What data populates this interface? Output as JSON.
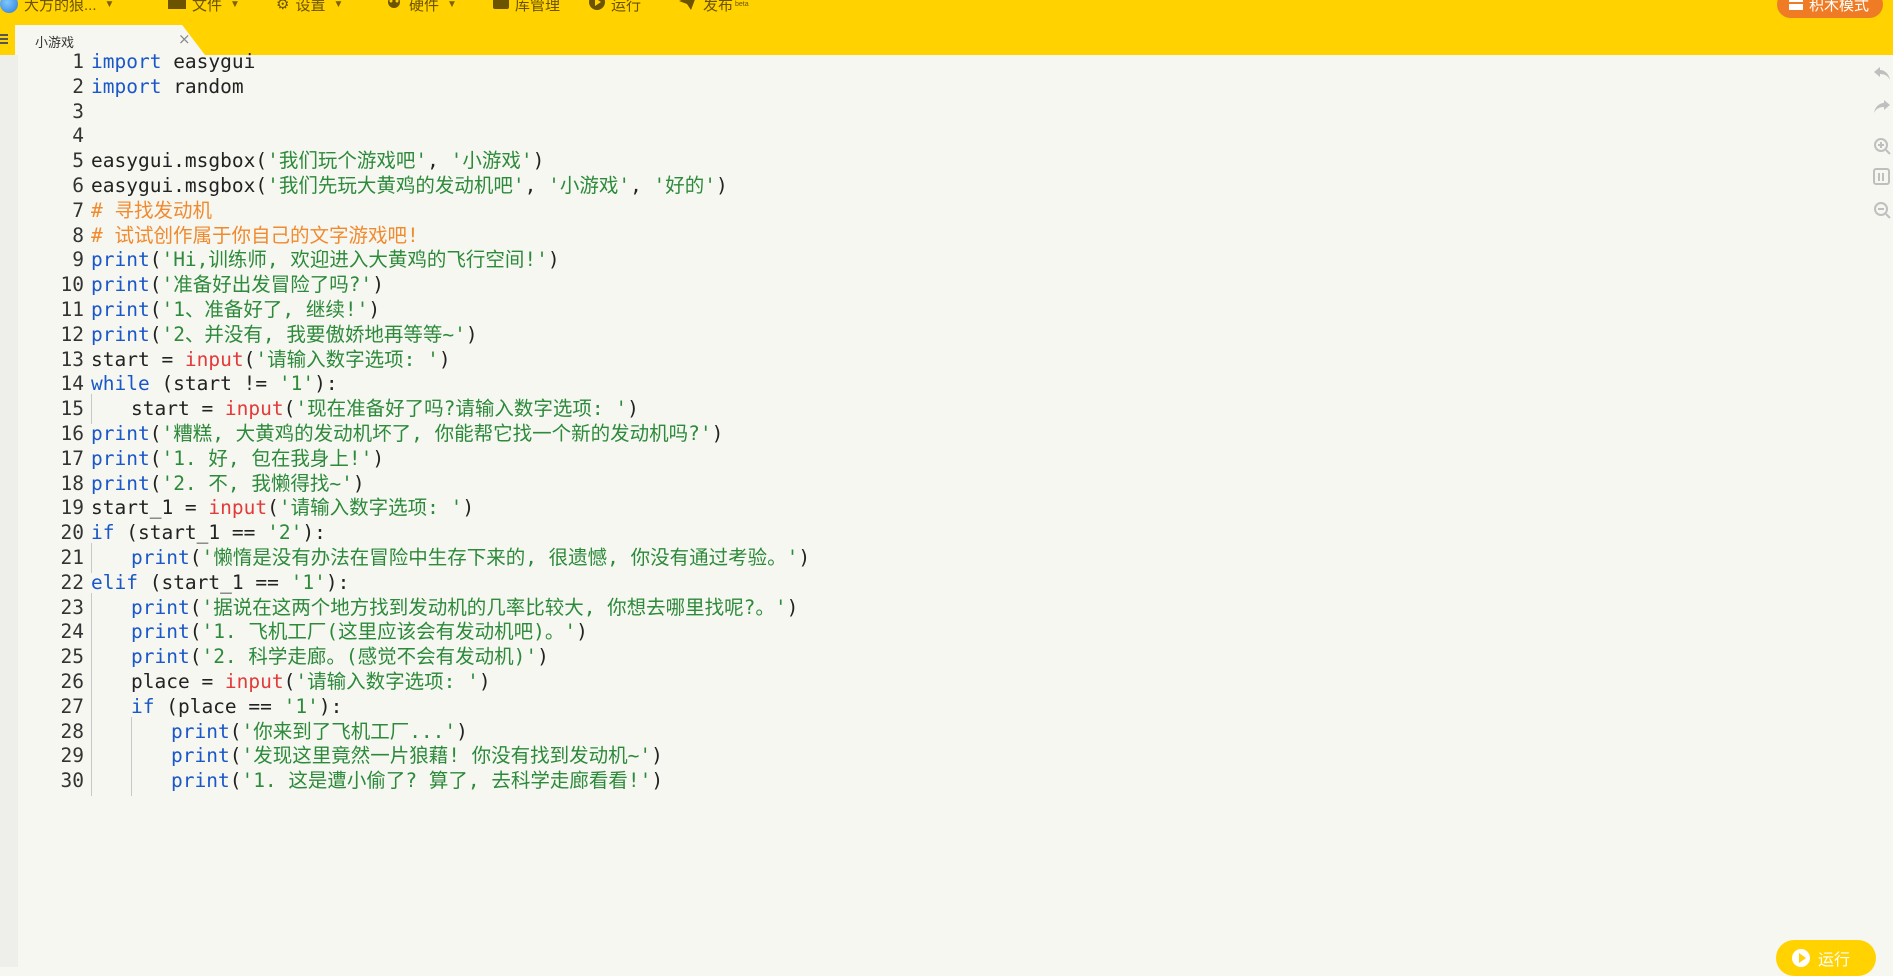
{
  "menu": {
    "project_name": "大方的狼...",
    "items": [
      "文件",
      "设置",
      "硬件",
      "库管理",
      "运行",
      "发布"
    ],
    "publish_badge": "beta",
    "mode_button": "积木模式"
  },
  "tab": {
    "label": "小游戏"
  },
  "run_button": "运行",
  "colors": {
    "topbar": "#ffd200",
    "keyword": "#1a57c8",
    "builtin": "#e33a3a",
    "string": "#2c8a3a",
    "comment": "#f08a2d",
    "mode_button": "#ef7c24"
  },
  "code_lines": [
    {
      "n": "1",
      "indent": 0,
      "tokens": [
        [
          "kw",
          "import"
        ],
        [
          "t",
          " easygui"
        ]
      ]
    },
    {
      "n": "2",
      "indent": 0,
      "tokens": [
        [
          "kw",
          "import"
        ],
        [
          "t",
          " random"
        ]
      ]
    },
    {
      "n": "3",
      "indent": 0,
      "tokens": []
    },
    {
      "n": "4",
      "indent": 0,
      "tokens": []
    },
    {
      "n": "5",
      "indent": 0,
      "tokens": [
        [
          "t",
          "easygui.msgbox("
        ],
        [
          "str",
          "'我们玩个游戏吧'"
        ],
        [
          "t",
          ", "
        ],
        [
          "str",
          "'小游戏'"
        ],
        [
          "t",
          ")"
        ]
      ]
    },
    {
      "n": "6",
      "indent": 0,
      "tokens": [
        [
          "t",
          "easygui.msgbox("
        ],
        [
          "str",
          "'我们先玩大黄鸡的发动机吧'"
        ],
        [
          "t",
          ", "
        ],
        [
          "str",
          "'小游戏'"
        ],
        [
          "t",
          ", "
        ],
        [
          "str",
          "'好的'"
        ],
        [
          "t",
          ")"
        ]
      ]
    },
    {
      "n": "7",
      "indent": 0,
      "tokens": [
        [
          "cm",
          "# 寻找发动机"
        ]
      ]
    },
    {
      "n": "8",
      "indent": 0,
      "tokens": [
        [
          "cm",
          "# 试试创作属于你自己的文字游戏吧!"
        ]
      ]
    },
    {
      "n": "9",
      "indent": 0,
      "tokens": [
        [
          "kw",
          "print"
        ],
        [
          "t",
          "("
        ],
        [
          "str",
          "'Hi,训练师, 欢迎进入大黄鸡的飞行空间!'"
        ],
        [
          "t",
          ")"
        ]
      ]
    },
    {
      "n": "10",
      "indent": 0,
      "tokens": [
        [
          "kw",
          "print"
        ],
        [
          "t",
          "("
        ],
        [
          "str",
          "'准备好出发冒险了吗?'"
        ],
        [
          "t",
          ")"
        ]
      ]
    },
    {
      "n": "11",
      "indent": 0,
      "tokens": [
        [
          "kw",
          "print"
        ],
        [
          "t",
          "("
        ],
        [
          "str",
          "'1、准备好了, 继续!'"
        ],
        [
          "t",
          ")"
        ]
      ]
    },
    {
      "n": "12",
      "indent": 0,
      "tokens": [
        [
          "kw",
          "print"
        ],
        [
          "t",
          "("
        ],
        [
          "str",
          "'2、并没有, 我要傲娇地再等等~'"
        ],
        [
          "t",
          ")"
        ]
      ]
    },
    {
      "n": "13",
      "indent": 0,
      "tokens": [
        [
          "t",
          "start = "
        ],
        [
          "fn",
          "input"
        ],
        [
          "t",
          "("
        ],
        [
          "str",
          "'请输入数字选项: '"
        ],
        [
          "t",
          ")"
        ]
      ]
    },
    {
      "n": "14",
      "indent": 0,
      "tokens": [
        [
          "kw",
          "while"
        ],
        [
          "t",
          " (start != "
        ],
        [
          "str",
          "'1'"
        ],
        [
          "t",
          "):"
        ]
      ]
    },
    {
      "n": "15",
      "indent": 1,
      "tokens": [
        [
          "t",
          "start = "
        ],
        [
          "fn",
          "input"
        ],
        [
          "t",
          "("
        ],
        [
          "str",
          "'现在准备好了吗?请输入数字选项: '"
        ],
        [
          "t",
          ")"
        ]
      ]
    },
    {
      "n": "16",
      "indent": 0,
      "tokens": [
        [
          "kw",
          "print"
        ],
        [
          "t",
          "("
        ],
        [
          "str",
          "'糟糕, 大黄鸡的发动机坏了, 你能帮它找一个新的发动机吗?'"
        ],
        [
          "t",
          ")"
        ]
      ]
    },
    {
      "n": "17",
      "indent": 0,
      "tokens": [
        [
          "kw",
          "print"
        ],
        [
          "t",
          "("
        ],
        [
          "str",
          "'1. 好, 包在我身上!'"
        ],
        [
          "t",
          ")"
        ]
      ]
    },
    {
      "n": "18",
      "indent": 0,
      "tokens": [
        [
          "kw",
          "print"
        ],
        [
          "t",
          "("
        ],
        [
          "str",
          "'2. 不, 我懒得找~'"
        ],
        [
          "t",
          ")"
        ]
      ]
    },
    {
      "n": "19",
      "indent": 0,
      "tokens": [
        [
          "t",
          "start_1 = "
        ],
        [
          "fn",
          "input"
        ],
        [
          "t",
          "("
        ],
        [
          "str",
          "'请输入数字选项: '"
        ],
        [
          "t",
          ")"
        ]
      ]
    },
    {
      "n": "20",
      "indent": 0,
      "tokens": [
        [
          "kw",
          "if"
        ],
        [
          "t",
          " (start_1 == "
        ],
        [
          "str",
          "'2'"
        ],
        [
          "t",
          "):"
        ]
      ]
    },
    {
      "n": "21",
      "indent": 1,
      "tokens": [
        [
          "kw",
          "print"
        ],
        [
          "t",
          "("
        ],
        [
          "str",
          "'懒惰是没有办法在冒险中生存下来的, 很遗憾, 你没有通过考验。'"
        ],
        [
          "t",
          ")"
        ]
      ]
    },
    {
      "n": "22",
      "indent": 0,
      "tokens": [
        [
          "kw",
          "elif"
        ],
        [
          "t",
          " (start_1 == "
        ],
        [
          "str",
          "'1'"
        ],
        [
          "t",
          "):"
        ]
      ]
    },
    {
      "n": "23",
      "indent": 1,
      "tokens": [
        [
          "kw",
          "print"
        ],
        [
          "t",
          "("
        ],
        [
          "str",
          "'据说在这两个地方找到发动机的几率比较大, 你想去哪里找呢?。'"
        ],
        [
          "t",
          ")"
        ]
      ]
    },
    {
      "n": "24",
      "indent": 1,
      "tokens": [
        [
          "kw",
          "print"
        ],
        [
          "t",
          "("
        ],
        [
          "str",
          "'1. 飞机工厂(这里应该会有发动机吧)。'"
        ],
        [
          "t",
          ")"
        ]
      ]
    },
    {
      "n": "25",
      "indent": 1,
      "tokens": [
        [
          "kw",
          "print"
        ],
        [
          "t",
          "("
        ],
        [
          "str",
          "'2. 科学走廊。(感觉不会有发动机)'"
        ],
        [
          "t",
          ")"
        ]
      ]
    },
    {
      "n": "26",
      "indent": 1,
      "tokens": [
        [
          "t",
          "place = "
        ],
        [
          "fn",
          "input"
        ],
        [
          "t",
          "("
        ],
        [
          "str",
          "'请输入数字选项: '"
        ],
        [
          "t",
          ")"
        ]
      ]
    },
    {
      "n": "27",
      "indent": 1,
      "tokens": [
        [
          "kw",
          "if"
        ],
        [
          "t",
          " (place == "
        ],
        [
          "str",
          "'1'"
        ],
        [
          "t",
          "):"
        ]
      ]
    },
    {
      "n": "28",
      "indent": 2,
      "tokens": [
        [
          "kw",
          "print"
        ],
        [
          "t",
          "("
        ],
        [
          "str",
          "'你来到了飞机工厂...'"
        ],
        [
          "t",
          ")"
        ]
      ]
    },
    {
      "n": "29",
      "indent": 2,
      "tokens": [
        [
          "kw",
          "print"
        ],
        [
          "t",
          "("
        ],
        [
          "str",
          "'发现这里竟然一片狼藉! 你没有找到发动机~'"
        ],
        [
          "t",
          ")"
        ]
      ]
    },
    {
      "n": "30",
      "indent": 2,
      "tokens": [
        [
          "kw",
          "print"
        ],
        [
          "t",
          "("
        ],
        [
          "str",
          "'1. 这是遭小偷了? 算了, 去科学走廊看看!'"
        ],
        [
          "t",
          ")"
        ]
      ]
    }
  ]
}
